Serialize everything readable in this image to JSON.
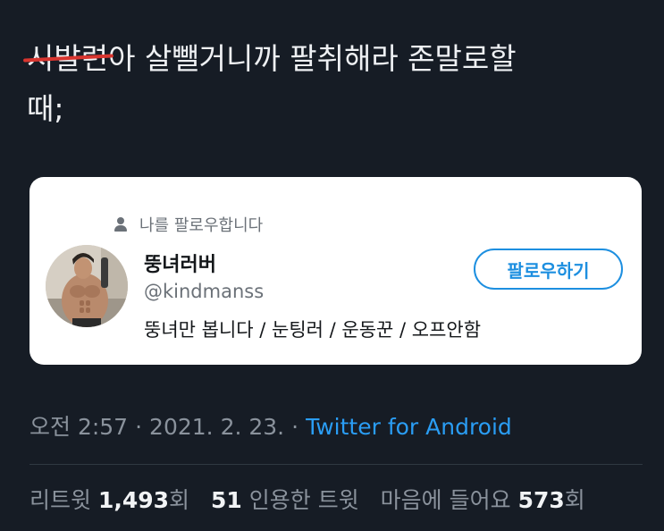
{
  "tweet": {
    "struck_text": "시발련",
    "text_after_strike": "아 살뺄거니까 팔취해라 존말로할",
    "text_line2": "때;"
  },
  "card": {
    "follows_you": "나를 팔로우합니다",
    "display_name": "뚱녀러버",
    "handle": "@kindmanss",
    "bio": "뚱녀만 봅니다 / 눈팅러 / 운동꾼 / 오프안함",
    "follow_button": "팔로우하기"
  },
  "meta": {
    "time": "오전 2:57",
    "dot1": "·",
    "date": "2021. 2. 23.",
    "dot2": "·",
    "client": "Twitter for Android"
  },
  "stats": {
    "retweets_label": "리트윗",
    "retweets_count": "1,493",
    "retweets_unit": "회",
    "quotes_count": "51",
    "quotes_label": "인용한 트윗",
    "likes_label": "마음에 들어요",
    "likes_count": "573",
    "likes_unit": "회"
  },
  "colors": {
    "background": "#161c25",
    "link_blue": "#2a9df4",
    "strike_red": "#d8352f"
  },
  "icons": {
    "follows_icon": "person-icon"
  }
}
